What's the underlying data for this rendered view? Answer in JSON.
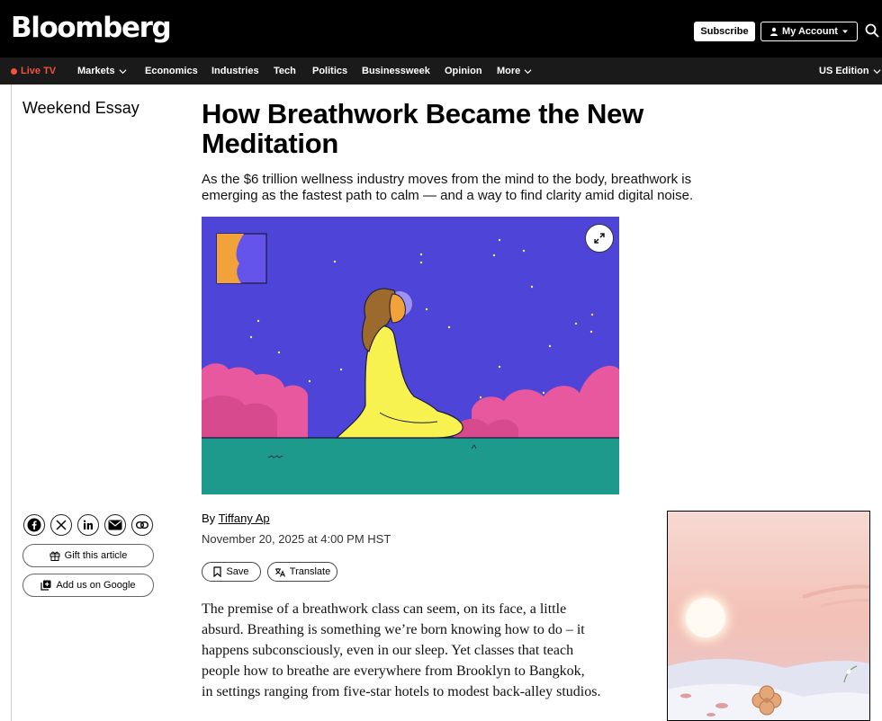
{
  "header": {
    "logo": "Bloomberg",
    "subscribe_label": "Subscribe",
    "account_label": "My Account",
    "search_icon": "search-icon"
  },
  "nav": {
    "live_label": "Live TV",
    "items": [
      {
        "label": "Markets",
        "has_dropdown": true
      },
      {
        "label": "Economics"
      },
      {
        "label": "Industries"
      },
      {
        "label": "Tech"
      },
      {
        "label": "Politics"
      },
      {
        "label": "Businessweek"
      },
      {
        "label": "Opinion"
      },
      {
        "label": "More",
        "has_dropdown": true
      }
    ],
    "edition_label": "US Edition"
  },
  "article": {
    "kicker": "Weekend Essay",
    "headline": "How Breathwork Became the New Meditation",
    "dek": "As the $6 trillion wellness industry moves from the mind to the body, breathwork is emerging as the fastest path to calm — and a way to find clarity amid digital noise.",
    "byline_prefix": "By",
    "author": "Tiffany Ap",
    "date": "November 20, 2025 at 4:00 PM HST",
    "save_label": "Save",
    "translate_label": "Translate",
    "body_lines": [
      "The premise of a breathwork class can seem, on its face, a little",
      "absurd. Breathing is something we’re born knowing how to do – it",
      "happens subconsciously, even in our sleep. Yet classes that teach",
      "people how to breathe are everywhere from Brooklyn to Bangkok,",
      "in settings ranging from five-star hotels to modest back-alley studios."
    ]
  },
  "share": {
    "icons": [
      "facebook-icon",
      "x-icon",
      "linkedin-icon",
      "email-icon",
      "link-icon"
    ],
    "gift_label": "Gift this article",
    "google_label": "Add us on Google"
  },
  "colors": {
    "live_red": "#f1533f",
    "hero_sky": "#4e44d8",
    "hero_clouds": "#e8589e",
    "hero_ground": "#1e9a8c",
    "hero_figure": "#f7f250"
  }
}
